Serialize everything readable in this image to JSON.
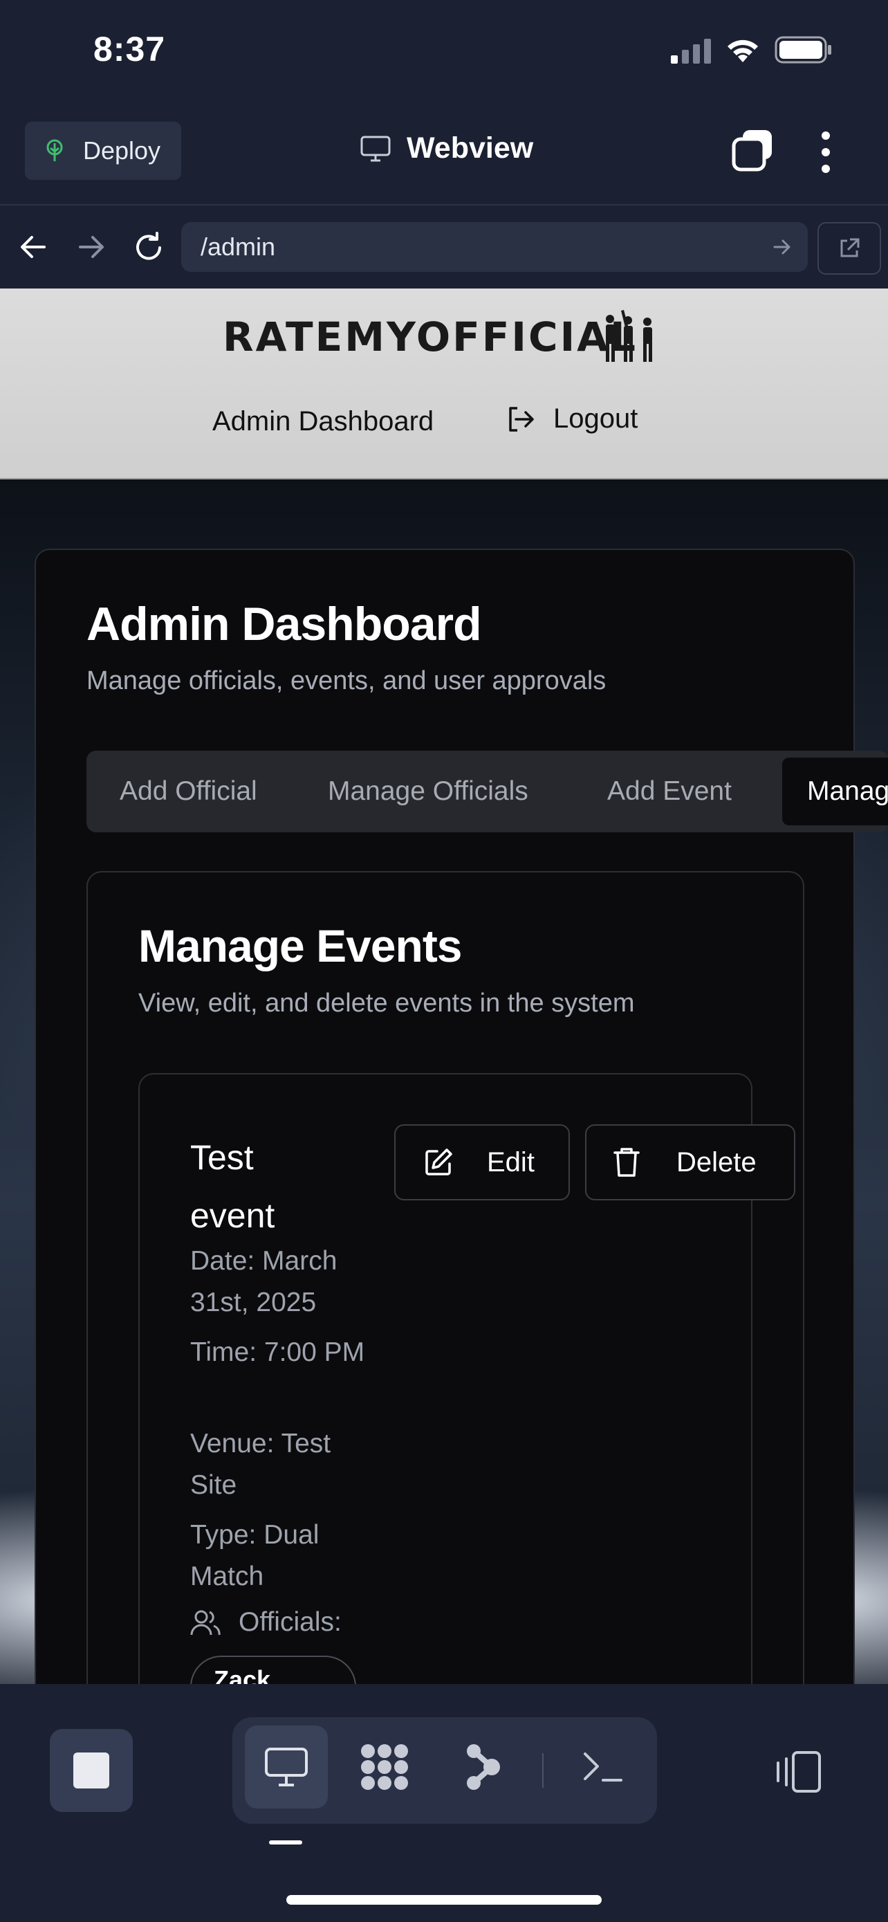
{
  "status_bar": {
    "time": "8:37",
    "signal_icon": "signal-icon",
    "wifi_icon": "wifi-icon",
    "battery_icon": "battery-icon"
  },
  "app_bar": {
    "deploy_label": "Deploy",
    "title": "Webview",
    "tabs_icon": "tabs-icon",
    "more_icon": "more-vertical-icon"
  },
  "browser": {
    "url": "/admin",
    "back_icon": "arrow-left-icon",
    "forward_icon": "arrow-right-icon",
    "reload_icon": "reload-icon",
    "go_icon": "go-arrow-icon",
    "open_external_icon": "external-link-icon"
  },
  "site": {
    "logo": "RATEMYOFFICIAL",
    "nav": {
      "dashboard": "Admin Dashboard",
      "logout": "Logout"
    }
  },
  "dashboard": {
    "title": "Admin Dashboard",
    "subtitle": "Manage officials, events, and user approvals",
    "tabs": [
      {
        "label": "Add Official",
        "active": false
      },
      {
        "label": "Manage Officials",
        "active": false
      },
      {
        "label": "Add Event",
        "active": false
      },
      {
        "label": "Manag",
        "active": true
      }
    ]
  },
  "manage_events": {
    "title": "Manage Events",
    "subtitle": "View, edit, and delete events in the system",
    "events": [
      {
        "name": "Test event",
        "date": "Date: March 31st, 2025",
        "time": "Time: 7:00 PM",
        "venue": "Venue: Test Site",
        "type": "Type: Dual Match",
        "officials_label": "Officials:",
        "officials": [
          "Zack"
        ],
        "edit_label": "Edit",
        "delete_label": "Delete"
      }
    ]
  },
  "bottom_bar": {
    "stop_icon": "stop-icon",
    "tools": [
      "monitor-icon",
      "apps-icon",
      "graph-icon",
      "terminal-icon"
    ],
    "layout_icon": "layout-icon"
  },
  "colors": {
    "background": "#1b2032",
    "card": "#0b0b0d",
    "accent_deploy": "#3fbf6f"
  }
}
